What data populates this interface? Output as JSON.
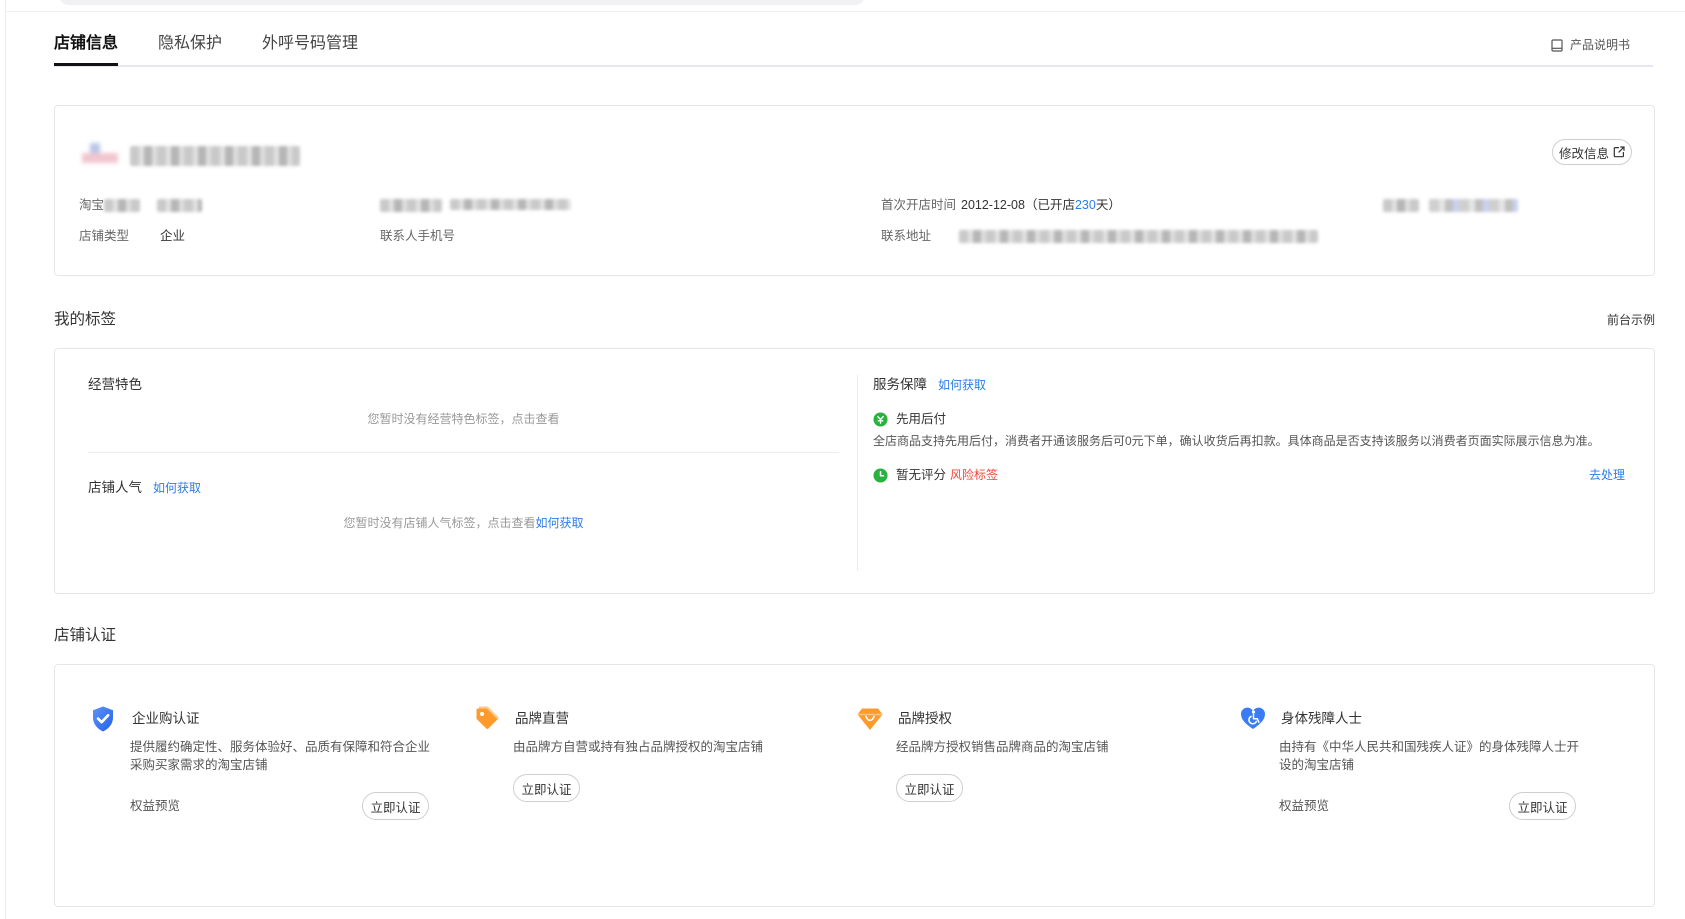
{
  "tabs": [
    {
      "label": "店铺信息",
      "active": true
    },
    {
      "label": "隐私保护",
      "active": false
    },
    {
      "label": "外呼号码管理",
      "active": false
    }
  ],
  "header": {
    "manual_label": "产品说明书",
    "manual_icon": "book-icon"
  },
  "shop_info": {
    "edit_label": "修改信息",
    "edit_icon": "external-edit-icon",
    "taobao_label_prefix": "淘宝",
    "shop_type_label": "店铺类型",
    "shop_type_value": "企业",
    "contact_phone_label": "联系人手机号",
    "first_open_label": "首次开店时间",
    "first_open_date": "2012-12-08",
    "open_days_prefix": "（已开店 ",
    "open_days": "230",
    "open_days_suffix": "天）",
    "address_label": "联系地址"
  },
  "tags": {
    "title": "我的标签",
    "frontend_example": "前台示例",
    "business_feature": {
      "label": "经营特色",
      "empty": "您暂时没有经营特色标签，点击查看"
    },
    "popularity": {
      "label": "店铺人气",
      "how_link": "如何获取",
      "empty": "您暂时没有店铺人气标签，点击查看",
      "empty_link": "如何获取"
    },
    "service": {
      "label": "服务保障",
      "how_link": "如何获取",
      "pay_later": {
        "title": "先用后付",
        "icon": "yen-badge-icon",
        "desc": "全店商品支持先用后付，消费者开通该服务后可0元下单，确认收货后再扣款。具体商品是否支持该服务以消费者页面实际展示信息为准。"
      },
      "rating": {
        "title": "暂无评分",
        "icon": "clock-icon",
        "risk": "风险标签",
        "action": "去处理"
      }
    }
  },
  "certification": {
    "title": "店铺认证",
    "items": [
      {
        "title": "企业购认证",
        "icon": "shield-check-icon",
        "desc": "提供履约确定性、服务体验好、品质有保障和符合企业采购买家需求的淘宝店铺",
        "benefits": "权益预览",
        "action": "立即认证"
      },
      {
        "title": "品牌直营",
        "icon": "tag-icon",
        "desc": "由品牌方自营或持有独占品牌授权的淘宝店铺",
        "action": "立即认证"
      },
      {
        "title": "品牌授权",
        "icon": "diamond-icon",
        "desc": "经品牌方授权销售品牌商品的淘宝店铺",
        "action": "立即认证"
      },
      {
        "title": "身体残障人士",
        "icon": "heart-wheelchair-icon",
        "desc": "由持有《中华人民共和国残疾人证》的身体残障人士开设的淘宝店铺",
        "benefits": "权益预览",
        "action": "立即认证"
      }
    ]
  },
  "colors": {
    "link": "#2b7de9",
    "risk": "#f2453a",
    "ok": "#2bb13f",
    "brand_blue": "#2e6cf0",
    "brand_orange": "#ff9a2b"
  }
}
